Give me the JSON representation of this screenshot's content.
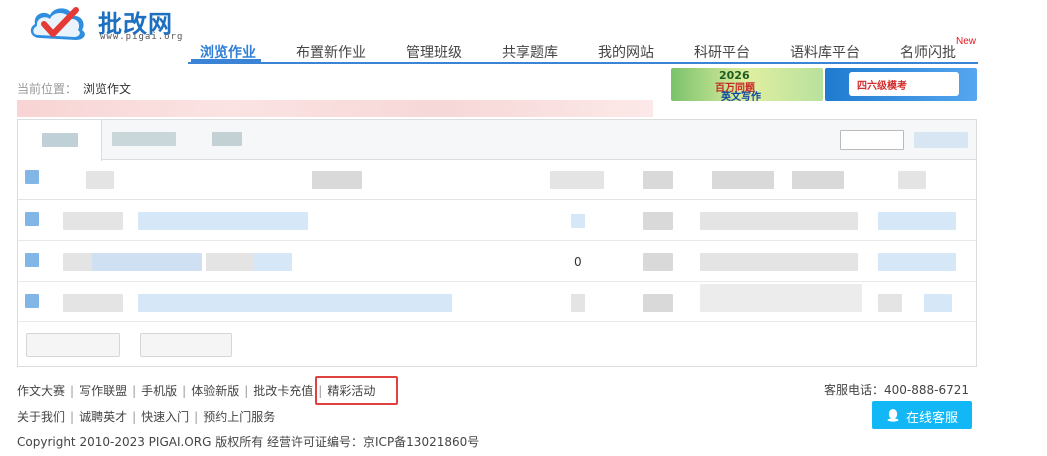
{
  "header": {
    "logo_title": "批改网",
    "logo_url": "www.pigai.org"
  },
  "nav": {
    "items": [
      "浏览作业",
      "布置新作业",
      "管理班级",
      "共享题库",
      "我的网站",
      "科研平台",
      "语料库平台",
      "名师闪批"
    ],
    "active_index": 0,
    "new_badge": "New"
  },
  "breadcrumb": {
    "label": "当前位置：",
    "current": "浏览作文"
  },
  "banners": {
    "banner1": {
      "year": "2026",
      "sub": "百万同题",
      "main": "英文写作"
    },
    "banner2": {
      "text": "四六级模考"
    }
  },
  "table": {
    "rows": [
      {
        "count": ""
      },
      {
        "count": "0"
      },
      {
        "count": ""
      }
    ]
  },
  "footer": {
    "links_row1": [
      "作文大赛",
      "写作联盟",
      "手机版",
      "体验新版",
      "批改卡充值",
      "精彩活动"
    ],
    "links_row2": [
      "关于我们",
      "诚聘英才",
      "快速入门",
      "预约上门服务"
    ],
    "copyright": "Copyright 2010-2023 PIGAI.ORG 版权所有 经营许可证编号：京ICP备13021860号",
    "phone": "客服电话：400-888-6721",
    "cs_button": "在线客服"
  },
  "colors": {
    "brand_blue": "#2f7fd8",
    "nav_line": "#3a83d5",
    "highlight": "#e0423f",
    "cs_button": "#12b7f5"
  }
}
